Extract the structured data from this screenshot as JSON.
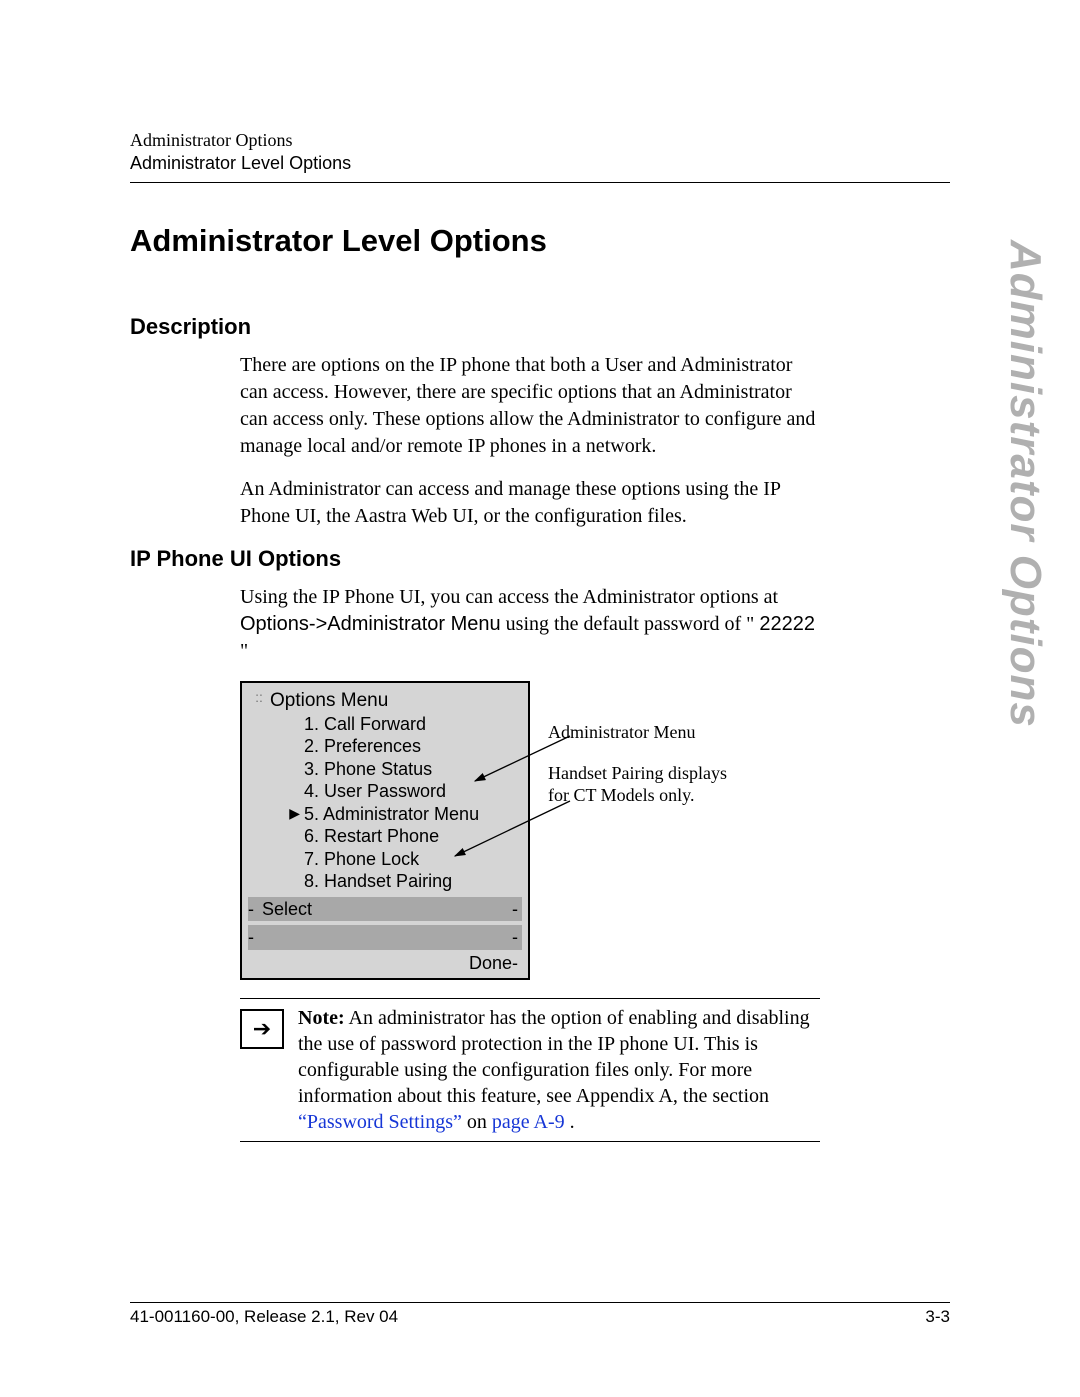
{
  "header": {
    "running": "Administrator Options",
    "sub": "Administrator Level Options"
  },
  "title": "Administrator Level Options",
  "side_label": "Administrator Options",
  "section1": {
    "heading": "Description",
    "para1": "There are options on the IP phone that both a User and Administrator can access. However, there are specific options that an Administrator can access only. These options allow the Administrator to configure and manage local and/or remote IP phones in a network.",
    "para2": "An Administrator can access and manage these options using the IP Phone UI, the Aastra Web UI, or the configuration files."
  },
  "section2": {
    "heading": "IP Phone UI Options",
    "intro_a": "Using the IP Phone UI, you can access the Administrator options at ",
    "intro_path": "Options->Administrator Menu",
    "intro_b": " using the default password of \"",
    "intro_pwd": "22222",
    "intro_c": "\""
  },
  "phone_menu": {
    "title": "Options Menu",
    "items": [
      "1. Call Forward",
      "2. Preferences",
      "3. Phone Status",
      "4. User Password",
      "5. Administrator Menu",
      "6. Restart Phone",
      "7. Phone Lock",
      "8. Handset Pairing"
    ],
    "select": "Select",
    "done": "Done"
  },
  "callouts": {
    "c1": "Administrator Menu",
    "c2": "Handset Pairing displays for CT Models only."
  },
  "note": {
    "bold": "Note:",
    "text_a": " An administrator has the option of enabling and disabling the use of password protection in the IP phone UI. This is configurable using the configuration files only. For more information about this feature, see Appendix A, the section ",
    "link1": "“Password Settings”",
    "mid": " on ",
    "link2": "page A-9",
    "end": "."
  },
  "footer": {
    "left": "41-001160-00, Release 2.1, Rev 04",
    "right": "3-3"
  }
}
